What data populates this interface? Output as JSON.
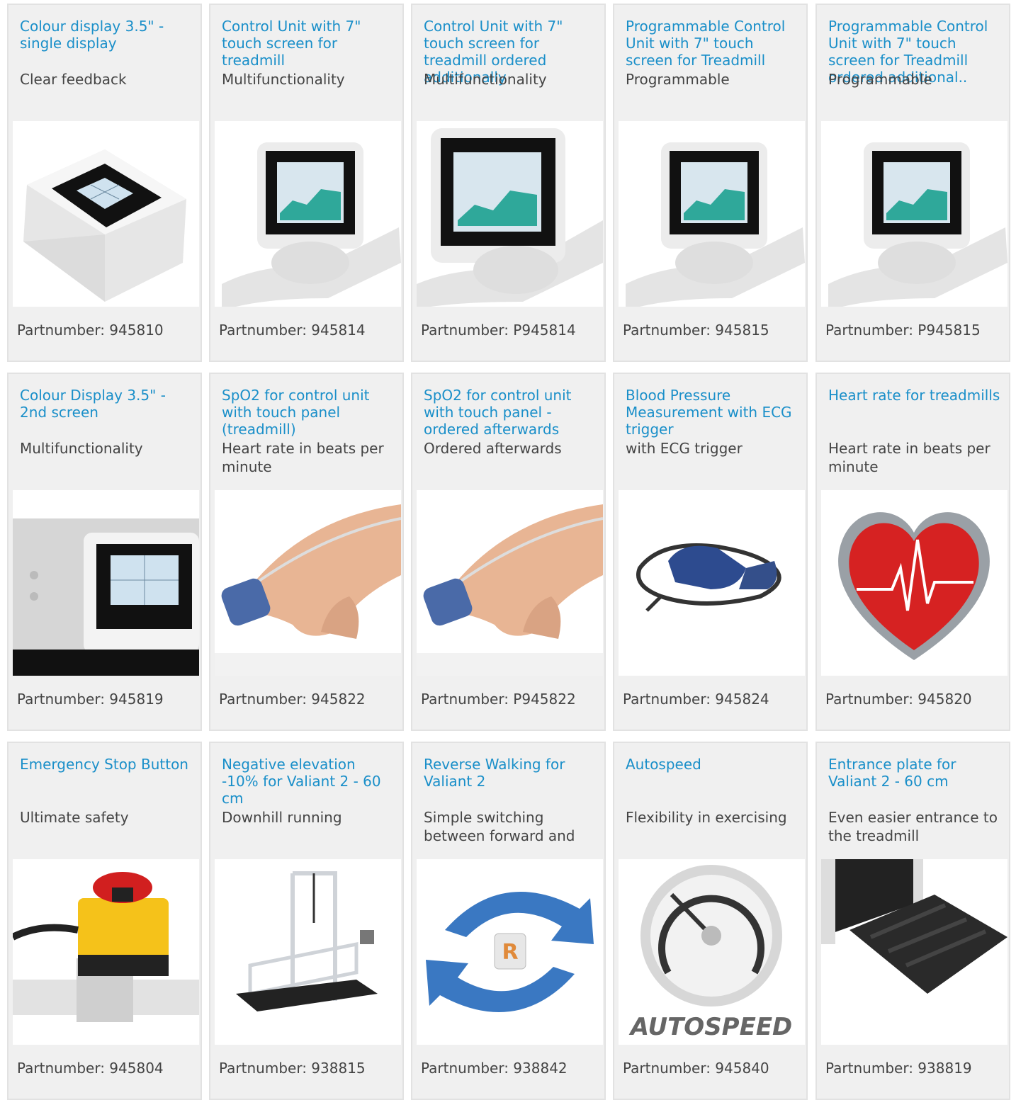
{
  "partnumber_label": "Partnumber: ",
  "products": [
    {
      "title": "Colour display 3.5\" - single display",
      "subtitle": "Clear feedback",
      "partnumber": "945810",
      "image": "display-3-5-icon"
    },
    {
      "title": "Control Unit with 7\" touch screen for treadmill",
      "subtitle": "Multifunctionality",
      "partnumber": "945814",
      "image": "touch-unit-icon"
    },
    {
      "title": "Control Unit with 7\" touch screen for treadmill ordered additionally",
      "subtitle": "Multifunctionality",
      "partnumber": "P945814",
      "image": "touch-unit-icon"
    },
    {
      "title": "Programmable Control Unit with 7\" touch screen for Treadmill",
      "subtitle": "Programmable",
      "partnumber": "945815",
      "image": "touch-unit-icon"
    },
    {
      "title": "Programmable Control Unit with 7\" touch screen for Treadmill ordered additional..",
      "subtitle": "Programmable",
      "partnumber": "P945815",
      "image": "touch-unit-icon"
    },
    {
      "title": "Colour Display 3.5\" - 2nd screen",
      "subtitle": "Multifunctionality",
      "partnumber": "945819",
      "image": "second-screen-icon"
    },
    {
      "title": "SpO2 for control unit with touch panel (treadmill)",
      "subtitle": "Heart rate in beats per minute",
      "partnumber": "945822",
      "image": "finger-sensor-icon"
    },
    {
      "title": "SpO2 for control unit with touch panel - ordered afterwards",
      "subtitle": "Ordered afterwards",
      "partnumber": "P945822",
      "image": "finger-sensor-icon"
    },
    {
      "title": "Blood Pressure Measurement with ECG trigger",
      "subtitle": "with ECG trigger",
      "partnumber": "945824",
      "image": "blood-pressure-cuff-icon"
    },
    {
      "title": "Heart rate for treadmills",
      "subtitle": "Heart rate in beats per minute",
      "partnumber": "945820",
      "image": "heart-rate-icon"
    },
    {
      "title": "Emergency Stop Button",
      "subtitle": "Ultimate safety",
      "partnumber": "945804",
      "image": "emergency-stop-icon"
    },
    {
      "title": "Negative elevation -10% for Valiant 2 - 60 cm",
      "subtitle": "Downhill running",
      "partnumber": "938815",
      "image": "treadmill-icon"
    },
    {
      "title": "Reverse Walking for Valiant 2",
      "subtitle": "Simple switching between forward and",
      "partnumber": "938842",
      "image": "reverse-arrows-icon"
    },
    {
      "title": "Autospeed",
      "subtitle": "Flexibility in exercising",
      "partnumber": "945840",
      "image": "autospeed-gauge-icon"
    },
    {
      "title": "Entrance plate for Valiant 2 - 60 cm",
      "subtitle": "Even easier entrance to the treadmill",
      "partnumber": "938819",
      "image": "entrance-plate-icon"
    }
  ],
  "autospeed_logo_text": "AUTOSPEED",
  "reverse_key_text": "R",
  "colors": {
    "link": "#1a8fc9",
    "card_bg": "#f0f0f0",
    "card_border": "#e2e2e2",
    "text": "#444444"
  }
}
